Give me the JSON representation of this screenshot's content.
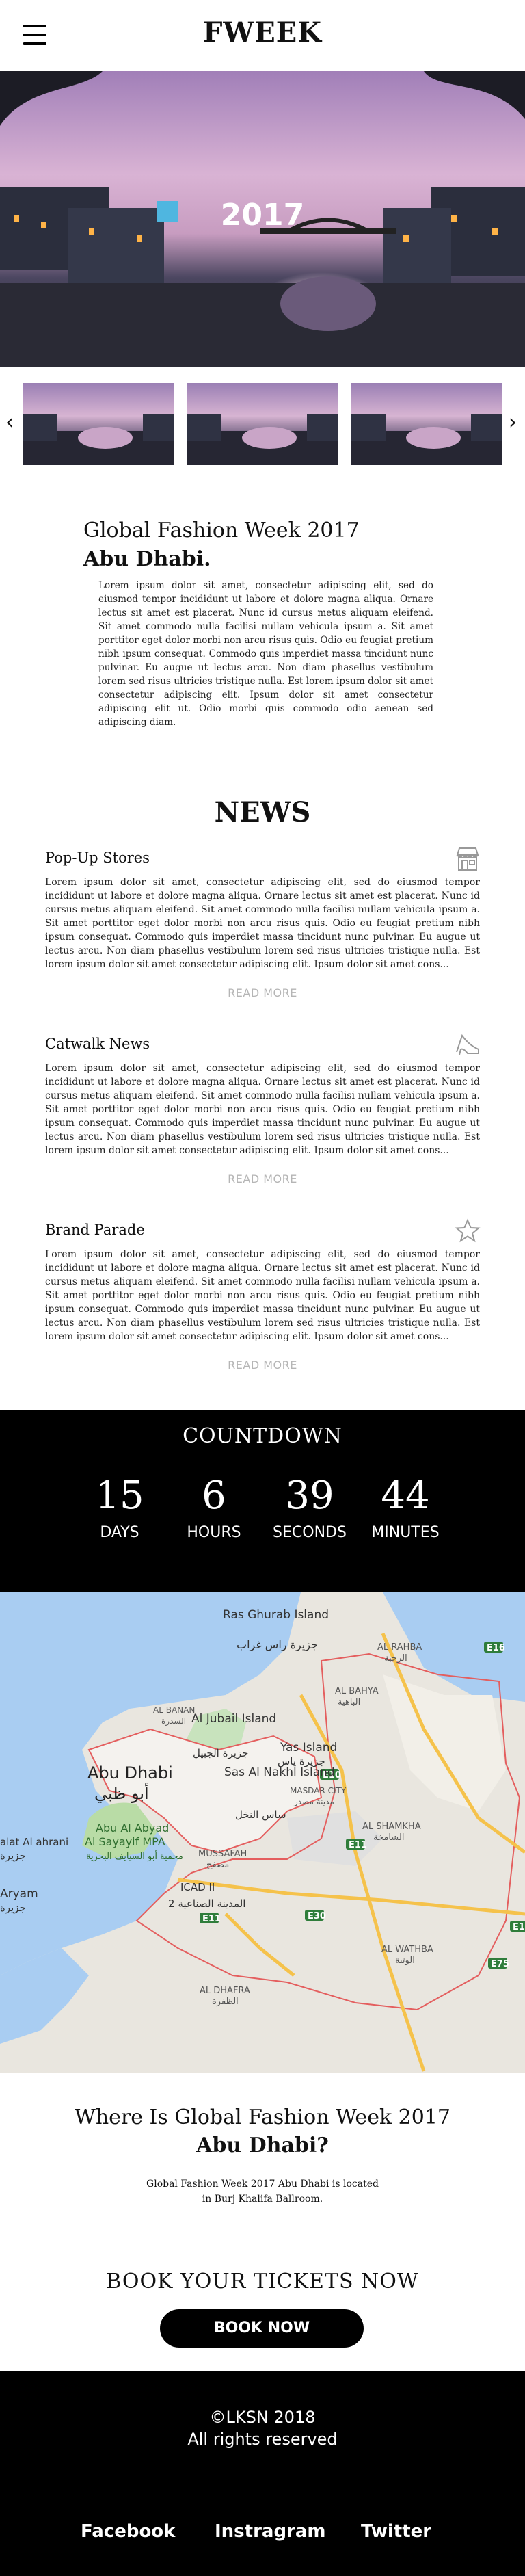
{
  "header": {
    "logo": "FWEEK"
  },
  "hero": {
    "year": "2017"
  },
  "intro": {
    "title": "Global Fashion Week 2017",
    "subtitle": "Abu Dhabi.",
    "body": "Lorem ipsum dolor sit amet, consectetur adipiscing elit, sed do eiusmod tempor incididunt ut labore et dolore magna aliqua. Ornare lectus sit amet est placerat. Nunc id cursus metus aliquam eleifend. Sit amet commodo nulla facilisi nullam vehicula ipsum a. Sit amet porttitor eget dolor morbi non arcu risus quis. Odio eu feugiat pretium nibh ipsum consequat. Commodo quis imperdiet massa tincidunt nunc pulvinar. Eu augue ut lectus arcu. Non diam phasellus vestibulum lorem sed risus ultricies tristique nulla. Est lorem ipsum dolor sit amet consectetur adipiscing elit. Ipsum dolor sit amet consectetur adipiscing elit ut. Odio morbi quis commodo odio aenean sed adipiscing diam."
  },
  "news": {
    "title": "NEWS",
    "items": [
      {
        "title": "Pop-Up Stores",
        "icon": "store-icon",
        "body": "Lorem ipsum dolor sit amet, consectetur adipiscing elit, sed do eiusmod tempor incididunt ut labore et dolore magna aliqua. Ornare lectus sit amet est placerat. Nunc id cursus metus aliquam eleifend. Sit amet commodo nulla facilisi nullam vehicula ipsum a. Sit amet porttitor eget dolor morbi non arcu risus quis. Odio eu feugiat pretium nibh ipsum consequat. Commodo quis imperdiet massa tincidunt nunc pulvinar. Eu augue ut lectus arcu. Non diam phasellus vestibulum lorem sed risus ultricies tristique nulla. Est lorem ipsum dolor sit amet consectetur adipiscing elit. Ipsum dolor sit amet cons...",
        "more": "READ MORE"
      },
      {
        "title": "Catwalk News",
        "icon": "high-heel-icon",
        "body": "Lorem ipsum dolor sit amet, consectetur adipiscing elit, sed do eiusmod tempor incididunt ut labore et dolore magna aliqua. Ornare lectus sit amet est placerat. Nunc id cursus metus aliquam eleifend. Sit amet commodo nulla facilisi nullam vehicula ipsum a. Sit amet porttitor eget dolor morbi non arcu risus quis. Odio eu feugiat pretium nibh ipsum consequat. Commodo quis imperdiet massa tincidunt nunc pulvinar. Eu augue ut lectus arcu. Non diam phasellus vestibulum lorem sed risus ultricies tristique nulla. Est lorem ipsum dolor sit amet consectetur adipiscing elit. Ipsum dolor sit amet cons...",
        "more": "READ MORE"
      },
      {
        "title": "Brand Parade",
        "icon": "star-icon",
        "body": "Lorem ipsum dolor sit amet, consectetur adipiscing elit, sed do eiusmod tempor incididunt ut labore et dolore magna aliqua. Ornare lectus sit amet est placerat. Nunc id cursus metus aliquam eleifend. Sit amet commodo nulla facilisi nullam vehicula ipsum a. Sit amet porttitor eget dolor morbi non arcu risus quis. Odio eu feugiat pretium nibh ipsum consequat. Commodo quis imperdiet massa tincidunt nunc pulvinar. Eu augue ut lectus arcu. Non diam phasellus vestibulum lorem sed risus ultricies tristique nulla. Est lorem ipsum dolor sit amet consectetur adipiscing elit. Ipsum dolor sit amet cons...",
        "more": "READ MORE"
      }
    ]
  },
  "countdown": {
    "title": "COUNTDOWN",
    "cells": [
      {
        "value": "15",
        "label": "DAYS"
      },
      {
        "value": "6",
        "label": "HOURS"
      },
      {
        "value": "39",
        "label": "SECONDS"
      },
      {
        "value": "44",
        "label": "MINUTES"
      }
    ]
  },
  "map": {
    "labels": {
      "ras_ghurab": "Ras Ghurab Island",
      "ras_ghurab_ar": "جزيرة راس غراب",
      "al_rahba": "AL RAHBA",
      "al_rahba_ar": "الرحبة",
      "al_bahya": "AL BAHYA",
      "al_bahya_ar": "الباهية",
      "al_jubail": "Al Jubail Island",
      "al_jubail_ar": "جزيرة الجبيل",
      "yas": "Yas Island",
      "yas_ar": "جزيرة ياس",
      "abu_dhabi": "Abu Dhabi",
      "abu_dhabi_ar": "أبو ظبي",
      "sas_al_nakhl": "Sas Al Nakhl Island",
      "sas_al_nakhl_ar": "ساس النخل",
      "masdar": "MASDAR CITY",
      "masdar_ar": "مدينة مصدر",
      "al_shamkha": "AL SHAMKHA",
      "al_shamkha_ar": "الشامخة",
      "mussafah": "MUSSAFAH",
      "mussafah_ar": "مصفح",
      "icad": "ICAD II",
      "icad_ar": "المدينة الصناعية 2",
      "abu_al_abyad": "Abu Al Abyad",
      "sayayif": "Al Sayayif MPA",
      "sayayif_ar": "محمية أبو السيايف البحرية",
      "bahrani": "alat Al ahrani",
      "bahrani_ar": "جزيرة",
      "aryam": "Aryam",
      "aryam_ar": "جزيرة",
      "al_wathba": "AL WATHBA",
      "al_wathba_ar": "الوثبة",
      "al_dhafra": "AL DHAFRA",
      "al_dhafra_ar": "الظفرة",
      "al_banan": "AL BANAN",
      "al_banan_ar": "السدرة"
    },
    "road_markers": [
      "E16",
      "E10",
      "E11",
      "E30",
      "E11",
      "E75",
      "E12"
    ]
  },
  "where": {
    "title": "Where Is Global Fashion Week 2017",
    "subtitle": "Abu Dhabi?",
    "line1": "Global Fashion Week 2017 Abu Dhabi is located",
    "line2": "in Burj Khalifa Ballroom."
  },
  "booking": {
    "title": "BOOK YOUR TICKETS NOW",
    "button": "BOOK NOW"
  },
  "footer": {
    "copyright": "©LKSN 2018",
    "rights": "All rights reserved",
    "links": [
      "Facebook",
      "Instragram",
      "Twitter"
    ]
  },
  "colors": {
    "accent": "#000000",
    "muted": "#b5b5b5",
    "water": "#a9cdf2",
    "land": "#e9e6df"
  }
}
